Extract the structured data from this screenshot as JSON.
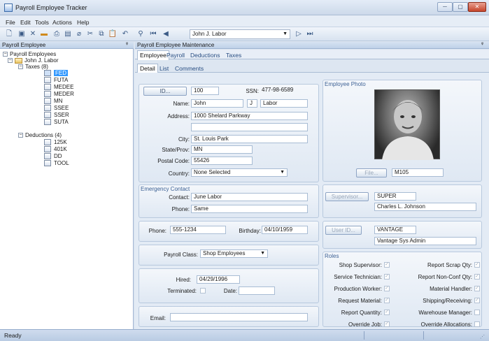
{
  "window": {
    "title": "Payroll Employee Tracker",
    "min": "─",
    "max": "▢",
    "close": "✕"
  },
  "menu": [
    "File",
    "Edit",
    "Tools",
    "Actions",
    "Help"
  ],
  "toolbar": {
    "selected_employee": "John J. Labor"
  },
  "left_panel": {
    "title": "Payroll Employee",
    "pin": "ᵠ",
    "tree": {
      "root": "Payroll Employees",
      "employee": "John J. Labor",
      "taxes": "Taxes (8)",
      "tax_items": [
        "FED",
        "FUTA",
        "MEDEE",
        "MEDER",
        "MN",
        "SSEE",
        "SSER",
        "SUTA"
      ],
      "deductions": "Deductions (4)",
      "deduction_items": [
        "125K",
        "401K",
        "DD",
        "TOOL"
      ]
    }
  },
  "right_panel": {
    "title": "Payroll Employee Maintenance",
    "pin": "ᵠ"
  },
  "tabs": [
    "Employee",
    "Payroll",
    "Deductions",
    "Taxes"
  ],
  "subtabs": [
    "Detail",
    "List",
    "Comments"
  ],
  "form": {
    "id_button": "ID...",
    "id": "100",
    "ssn_label": "SSN:",
    "ssn": "477-98-6589",
    "name_label": "Name:",
    "first": "John",
    "middle": "J",
    "last": "Labor",
    "address_label": "Address:",
    "address1": "1000 Shelard Parkway",
    "address2": "",
    "city_label": "City:",
    "city": "St. Louis Park",
    "state_label": "State/Prov:",
    "state": "MN",
    "postal_label": "Postal Code:",
    "postal": "55426",
    "country_label": "Country:",
    "country": "None Selected",
    "emergency_title": "Emergency Contact",
    "contact_label": "Contact:",
    "contact": "June Labor",
    "ephone_label": "Phone:",
    "ephone": "Same",
    "phone_label": "Phone:",
    "phone": "555-1234",
    "birthday_label": "Birthday:",
    "birthday": "04/10/1959",
    "payclass_label": "Payroll Class:",
    "payclass": "Shop Employees",
    "hired_label": "Hired:",
    "hired": "04/29/1996",
    "terminated_label": "Terminated:",
    "date_label": "Date:",
    "date": "",
    "email_label": "Email:",
    "email": ""
  },
  "photo": {
    "title": "Employee Photo",
    "file_button": "File...",
    "file": "M105"
  },
  "supervisor": {
    "button": "Supervisor...",
    "code": "SUPER",
    "name": "Charles L. Johnson"
  },
  "user": {
    "button": "User ID...",
    "code": "VANTAGE",
    "name": "Vantage Sys Admin"
  },
  "roles": {
    "title": "Roles",
    "left": [
      "Shop Supervisor:",
      "Service Technician:",
      "Production Worker:",
      "Request Material:",
      "Report Quantity:",
      "Override Job:"
    ],
    "right": [
      "Report Scrap Qty:",
      "Report Non-Conf Qty:",
      "Material Handler:",
      "Shipping/Receiving:",
      "Warehouse Manager:",
      "Override Allocations:"
    ]
  },
  "status": {
    "text": "Ready"
  }
}
